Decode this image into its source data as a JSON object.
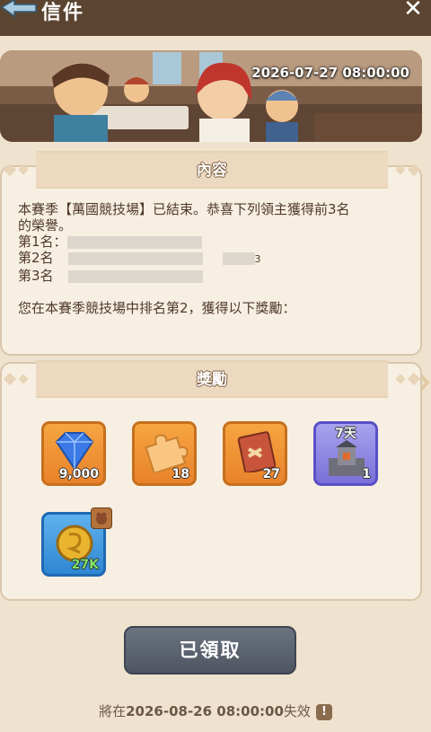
{
  "header": {
    "title": "信件",
    "back_icon": "back-arrow-icon",
    "close_icon": "close-icon",
    "close_glyph": "✕"
  },
  "banner": {
    "date": "2026-07-27 08:00:00"
  },
  "content": {
    "title": "內容",
    "text_line1": "本賽季【萬國競技場】已結束。恭喜下列領主獲得前3名",
    "text_line2": "的榮譽。",
    "rank1_label": "第1名：",
    "rank2_label": "第2名",
    "rank3_label": "第3名",
    "rank2_suffix": "3",
    "rank_line": "您在本賽季競技場中排名第2，獲得以下獎勵："
  },
  "rewards": {
    "title": "獎勵",
    "items": [
      {
        "icon": "diamond-icon",
        "count": "9,000"
      },
      {
        "icon": "puzzle-piece-icon",
        "count": "18"
      },
      {
        "icon": "scroll-book-icon",
        "count": "27"
      },
      {
        "icon": "castle-skin-icon",
        "count": "1",
        "days": "7天"
      },
      {
        "icon": "gold-coin-icon",
        "count": "27K"
      }
    ]
  },
  "claim_button": {
    "label": "已領取"
  },
  "footer": {
    "expire_prefix": "將在",
    "expire_date": "2026-08-26 08:00:00",
    "expire_suffix": "失效",
    "info_glyph": "!"
  },
  "colors": {
    "accent": "#e9822b",
    "panel_bg": "#f7efe2",
    "page_bg": "#efe3cf",
    "topbar": "#5b4530"
  }
}
